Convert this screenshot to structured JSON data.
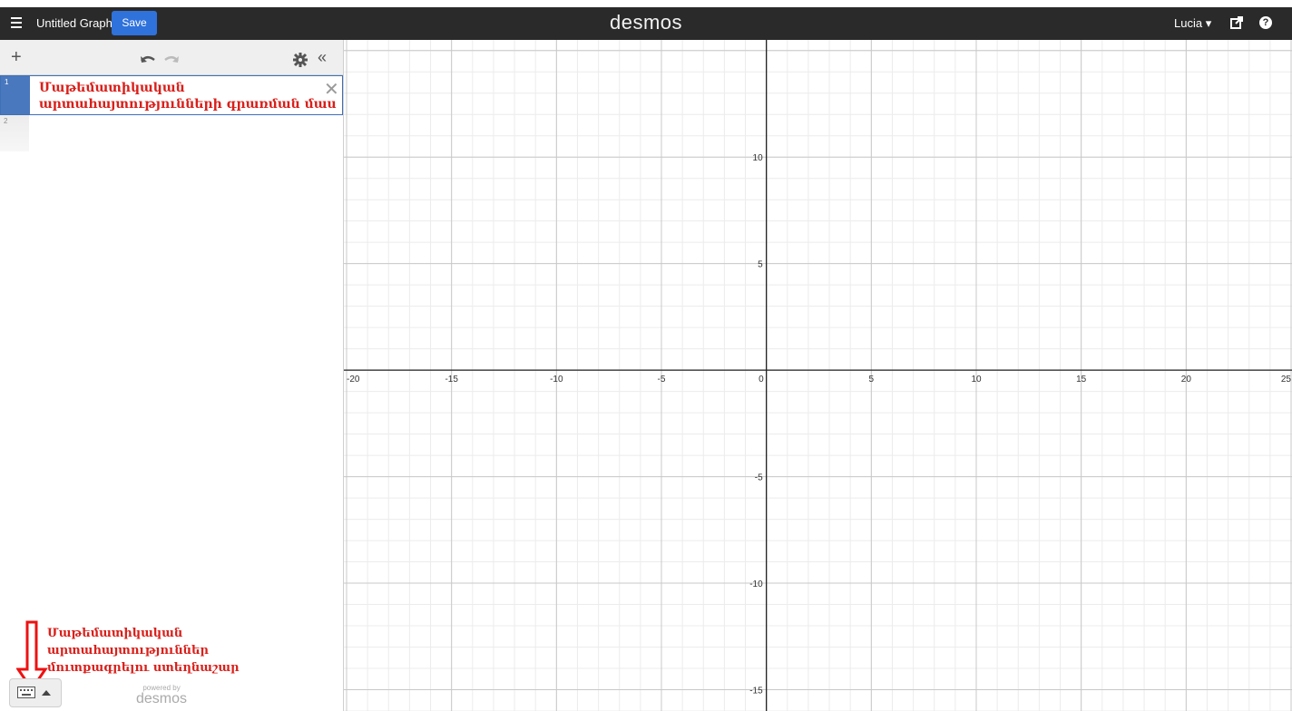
{
  "app": {
    "title": "Untitled Graph",
    "save_label": "Save",
    "logo": "desmos",
    "user": "Lucia ▾",
    "help_label": "?"
  },
  "panel": {
    "rows": [
      {
        "index": "1",
        "text_line1": "Մաթեմատիկական",
        "text_line2": "արտահայտությունների գրառման մաս"
      },
      {
        "index": "2"
      }
    ],
    "powered_by": "powered by",
    "powered_logo": "desmos"
  },
  "annotation": {
    "line1": "Մաթեմատիկական արտահայտություններ",
    "line2": "մուտքագրելու ստեղնաշար"
  },
  "graph": {
    "x_ticks": [
      "-20",
      "-15",
      "-10",
      "-5",
      "0",
      "5",
      "10",
      "15",
      "20",
      "25"
    ],
    "y_ticks": [
      "10",
      "5",
      "-5",
      "-10",
      "-15"
    ],
    "x_range": [
      -20,
      25
    ],
    "y_range": [
      -16,
      15.5
    ],
    "grid": true
  },
  "colors": {
    "topbar": "#2a2a2a",
    "save": "#2f72dc",
    "annotation": "#d9201b",
    "row_index": "#4a78be"
  }
}
